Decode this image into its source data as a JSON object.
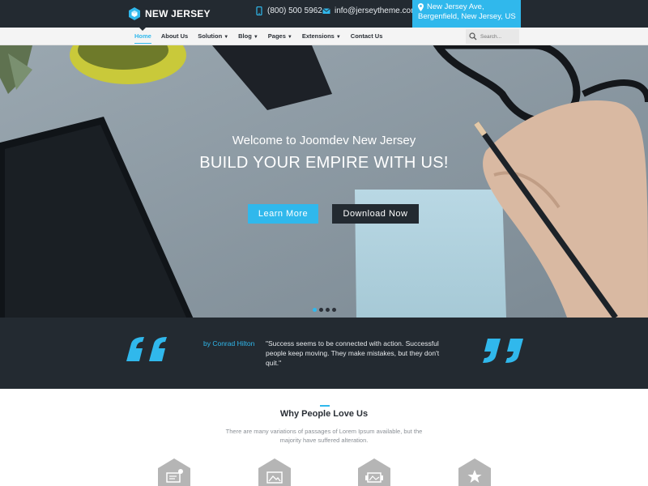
{
  "brand": {
    "name": "NEW JERSEY"
  },
  "topbar": {
    "phone": "(800) 500 5962",
    "email": "info@jerseytheme.com",
    "address_line1": "New Jersey Ave,",
    "address_line2": "Bergenfield, New Jersey, US"
  },
  "nav": {
    "items": [
      {
        "label": "Home"
      },
      {
        "label": "About Us"
      },
      {
        "label": "Solution"
      },
      {
        "label": "Blog"
      },
      {
        "label": "Pages"
      },
      {
        "label": "Extensions"
      },
      {
        "label": "Contact Us"
      }
    ],
    "search_placeholder": "Search..."
  },
  "hero": {
    "subtitle": "Welcome to Joomdev New Jersey",
    "title": "BUILD YOUR EMPIRE WITH US!",
    "primary_button": "Learn More",
    "secondary_button": "Download Now",
    "slide_count": 4,
    "active_slide": 1
  },
  "testimonial": {
    "author": "by Conrad Hilton",
    "quote": "\"Success seems to be connected with action. Successful people keep moving. They make mistakes, but they don't quit.\""
  },
  "why": {
    "title": "Why People Love Us",
    "description": "There are many variations of passages of Lorem Ipsum available, but the majority have suffered alteration."
  },
  "features": [
    {
      "icon": "certificate-icon"
    },
    {
      "icon": "image-icon"
    },
    {
      "icon": "gallery-icon"
    },
    {
      "icon": "star-icon"
    }
  ],
  "colors": {
    "accent": "#30b8ec",
    "dark": "#232a31",
    "nav_bg": "#f4f4f4",
    "feature_gray": "#b5b5b5"
  }
}
